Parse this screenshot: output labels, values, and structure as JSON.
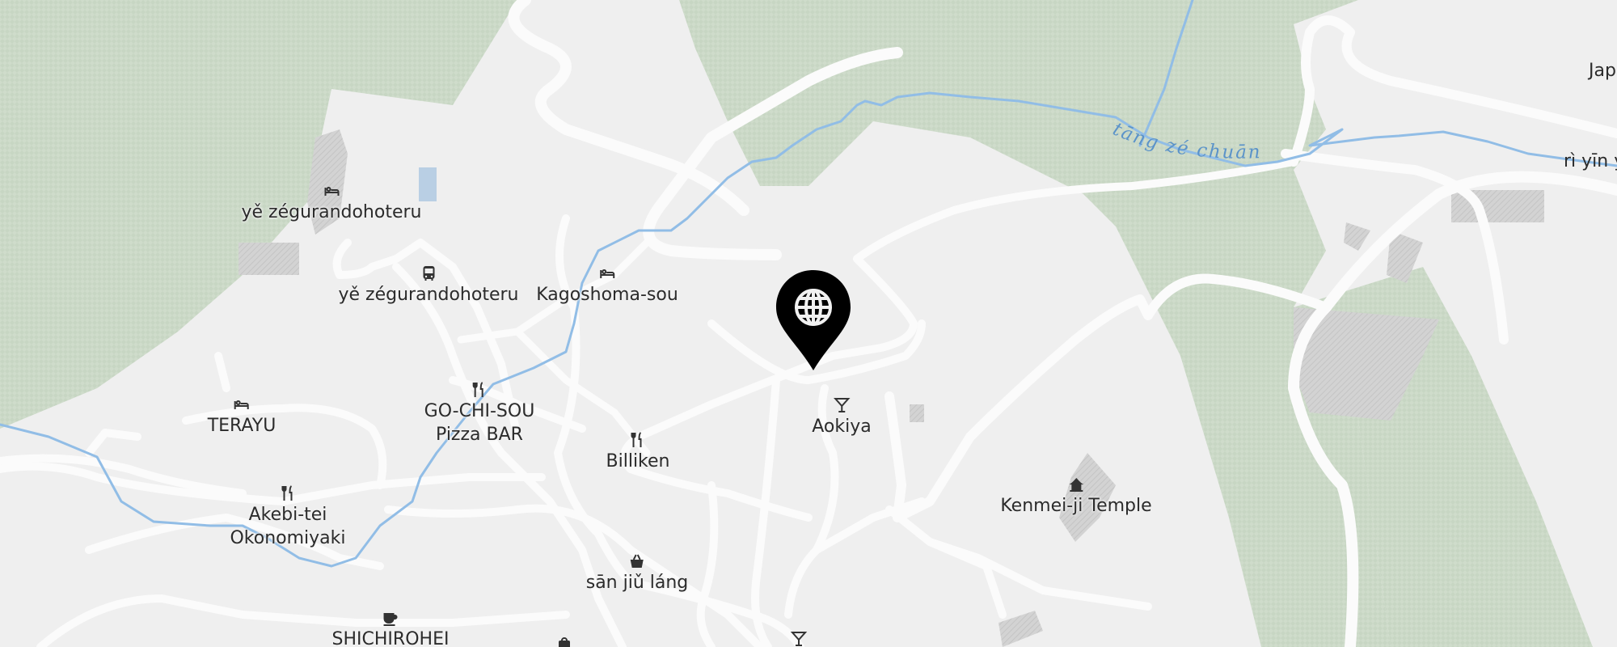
{
  "map": {
    "colors": {
      "land": "#efefef",
      "forest": "#cfdccb",
      "road": "#fbfbfb",
      "river": "#91bde6",
      "building": "#d6d6d6",
      "text": "#2b2b2b",
      "marker": "#000000"
    },
    "water_labels": [
      {
        "text": "tāng zé chuān"
      }
    ],
    "edge_labels": {
      "top_right": "Jap",
      "right": "rì yīn y"
    },
    "pois": [
      {
        "id": "hotel-1",
        "icon": "bed-icon",
        "label": "yě zégurandohoteru"
      },
      {
        "id": "bus-stop",
        "icon": "bus-icon",
        "label": "yě zégurandohoteru"
      },
      {
        "id": "kagoshoma",
        "icon": "bed-icon",
        "label": "Kagoshoma-sou"
      },
      {
        "id": "terayu",
        "icon": "bed-icon",
        "label": "TERAYU"
      },
      {
        "id": "gochisou",
        "icon": "restaurant-icon",
        "label": "GO-CHI-SOU\nPizza BAR"
      },
      {
        "id": "billiken",
        "icon": "restaurant-icon",
        "label": "Billiken"
      },
      {
        "id": "aokiya",
        "icon": "cocktail-icon",
        "label": "Aokiya"
      },
      {
        "id": "kenmeiji",
        "icon": "temple-icon",
        "label": "Kenmei-ji Temple"
      },
      {
        "id": "akebitei",
        "icon": "restaurant-icon",
        "label": "Akebi-tei\nOkonomiyaki"
      },
      {
        "id": "sanjiulang",
        "icon": "shop-bag-icon",
        "label": "sān jiǔ láng"
      },
      {
        "id": "shichirohei",
        "icon": "cafe-icon",
        "label": "SHICHIROHEI"
      },
      {
        "id": "bottom-bar",
        "icon": "cocktail-icon",
        "label": ""
      },
      {
        "id": "bottom-shop",
        "icon": "shop-icon",
        "label": ""
      }
    ],
    "selected_marker": {
      "icon": "globe-icon"
    }
  }
}
